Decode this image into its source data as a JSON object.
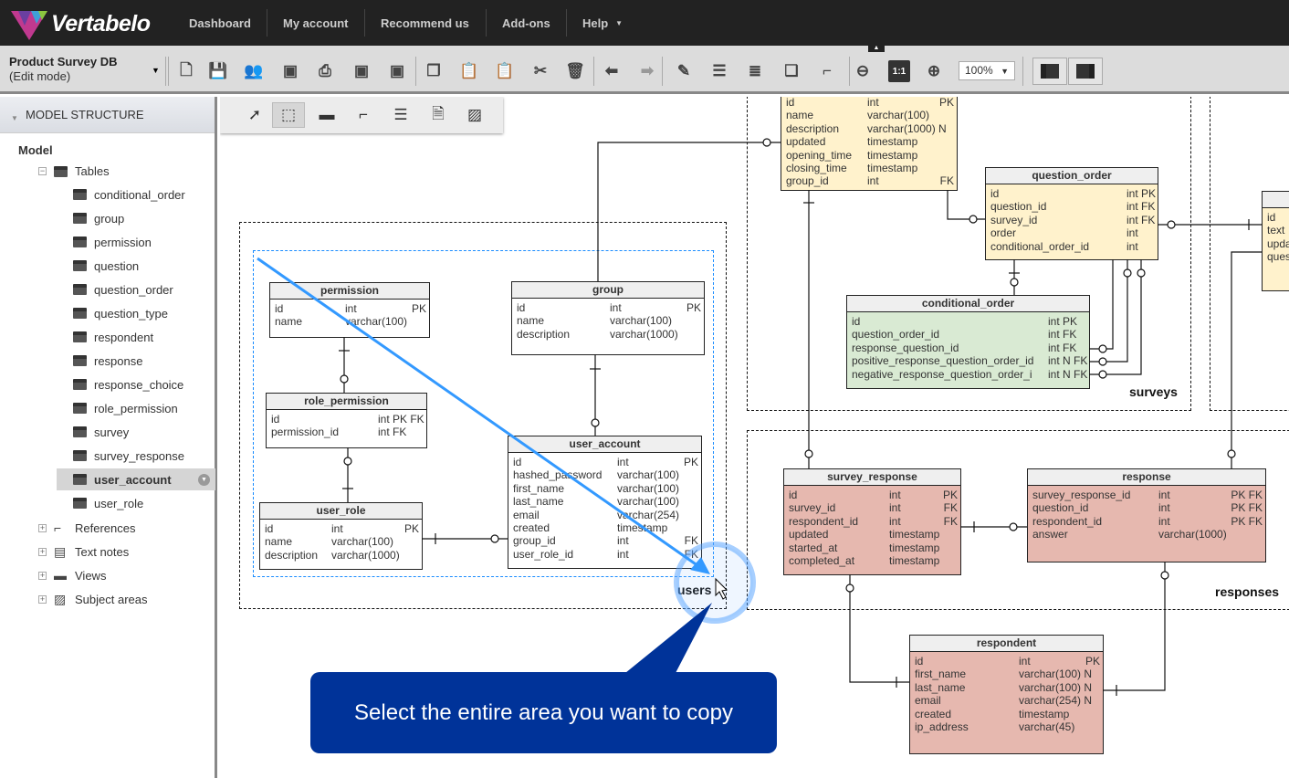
{
  "app": {
    "brand": "Vertabelo",
    "nav": [
      "Dashboard",
      "My account",
      "Recommend us",
      "Add-ons",
      "Help"
    ]
  },
  "toolbar": {
    "model_name": "Product Survey DB",
    "mode": "(Edit mode)",
    "zoom": "100%",
    "icons": [
      "new-document-icon",
      "save-icon",
      "users-icon",
      "png-export-icon",
      "print-icon",
      "sql-export-icon",
      "xml-export-icon",
      "copy-icon",
      "paste-icon",
      "paste-special-icon",
      "cut-icon",
      "delete-icon",
      "undo-arrow-icon",
      "redo-arrow-icon",
      "edit-icon",
      "align-icon",
      "format-icon",
      "layers-icon",
      "line-style-icon",
      "zoom-out-icon",
      "zoom-reset-icon",
      "zoom-in-icon"
    ],
    "zoom_reset_label": "1:1"
  },
  "sidebar": {
    "header": "MODEL STRUCTURE",
    "root": "Model",
    "tables_label": "Tables",
    "tables": [
      "conditional_order",
      "group",
      "permission",
      "question",
      "question_order",
      "question_type",
      "respondent",
      "response",
      "response_choice",
      "role_permission",
      "survey",
      "survey_response",
      "user_account",
      "user_role"
    ],
    "selected": "user_account",
    "sections": [
      "References",
      "Text notes",
      "Views",
      "Subject areas"
    ]
  },
  "diagram": {
    "areas": [
      "users",
      "surveys",
      "responses"
    ],
    "tables": [
      {
        "name": "",
        "color": "#fff2cc",
        "rows": [
          [
            "id",
            "int",
            "PK"
          ],
          [
            "name",
            "varchar(100)",
            ""
          ],
          [
            "description",
            "varchar(1000) N",
            ""
          ],
          [
            "updated",
            "timestamp",
            ""
          ],
          [
            "opening_time",
            "timestamp",
            ""
          ],
          [
            "closing_time",
            "timestamp",
            ""
          ],
          [
            "group_id",
            "int",
            "FK"
          ]
        ]
      },
      {
        "name": "question_order",
        "color": "#fff2cc",
        "rows": [
          [
            "id",
            "int PK",
            ""
          ],
          [
            "question_id",
            "int FK",
            ""
          ],
          [
            "survey_id",
            "int FK",
            ""
          ],
          [
            "order",
            "int",
            ""
          ],
          [
            "conditional_order_id",
            "int",
            ""
          ]
        ]
      },
      {
        "name": "",
        "color": "#fff2cc",
        "rows": [
          [
            "id",
            "",
            ""
          ],
          [
            "text",
            "",
            ""
          ],
          [
            "upda",
            "",
            ""
          ],
          [
            "ques",
            "",
            ""
          ]
        ]
      },
      {
        "name": "conditional_order",
        "color": "#d9ead3",
        "rows": [
          [
            "id",
            "int PK",
            ""
          ],
          [
            "question_order_id",
            "int FK",
            ""
          ],
          [
            "response_question_id",
            "int FK",
            ""
          ],
          [
            "positive_response_question_order_id",
            "int N FK",
            ""
          ],
          [
            "negative_response_question_order_i",
            "int N FK",
            ""
          ]
        ]
      },
      {
        "name": "permission",
        "color": "#ffffff",
        "rows": [
          [
            "id",
            "int",
            "PK"
          ],
          [
            "name",
            "varchar(100)",
            ""
          ]
        ]
      },
      {
        "name": "group",
        "color": "#ffffff",
        "rows": [
          [
            "id",
            "int",
            "PK"
          ],
          [
            "name",
            "varchar(100)",
            ""
          ],
          [
            "description",
            "varchar(1000)",
            ""
          ]
        ]
      },
      {
        "name": "role_permission",
        "color": "#ffffff",
        "rows": [
          [
            "id",
            "int PK FK",
            ""
          ],
          [
            "permission_id",
            "int FK",
            ""
          ]
        ]
      },
      {
        "name": "user_role",
        "color": "#ffffff",
        "rows": [
          [
            "id",
            "int",
            "PK"
          ],
          [
            "name",
            "varchar(100)",
            ""
          ],
          [
            "description",
            "varchar(1000)",
            ""
          ]
        ]
      },
      {
        "name": "user_account",
        "color": "#ffffff",
        "rows": [
          [
            "id",
            "int",
            "PK"
          ],
          [
            "hashed_password",
            "varchar(100)",
            ""
          ],
          [
            "first_name",
            "varchar(100)",
            ""
          ],
          [
            "last_name",
            "varchar(100)",
            ""
          ],
          [
            "email",
            "varchar(254)",
            ""
          ],
          [
            "created",
            "timestamp",
            ""
          ],
          [
            "group_id",
            "int",
            "FK"
          ],
          [
            "user_role_id",
            "int",
            "FK"
          ]
        ]
      },
      {
        "name": "survey_response",
        "color": "#e6b8af",
        "rows": [
          [
            "id",
            "int",
            "PK"
          ],
          [
            "survey_id",
            "int",
            "FK"
          ],
          [
            "respondent_id",
            "int",
            "FK"
          ],
          [
            "updated",
            "timestamp",
            ""
          ],
          [
            "started_at",
            "timestamp",
            ""
          ],
          [
            "completed_at",
            "timestamp",
            ""
          ]
        ]
      },
      {
        "name": "response",
        "color": "#e6b8af",
        "rows": [
          [
            "survey_response_id",
            "int",
            "PK FK"
          ],
          [
            "question_id",
            "int",
            "PK FK"
          ],
          [
            "respondent_id",
            "int",
            "PK FK"
          ],
          [
            "answer",
            "varchar(1000)",
            ""
          ]
        ]
      },
      {
        "name": "respondent",
        "color": "#e6b8af",
        "rows": [
          [
            "id",
            "int",
            "PK"
          ],
          [
            "first_name",
            "varchar(100) N",
            ""
          ],
          [
            "last_name",
            "varchar(100) N",
            ""
          ],
          [
            "email",
            "varchar(254) N",
            ""
          ],
          [
            "created",
            "timestamp",
            ""
          ],
          [
            "ip_address",
            "varchar(45)",
            ""
          ]
        ]
      }
    ]
  },
  "callout": {
    "text": "Select the entire area you want to copy",
    "color": "#003399"
  }
}
